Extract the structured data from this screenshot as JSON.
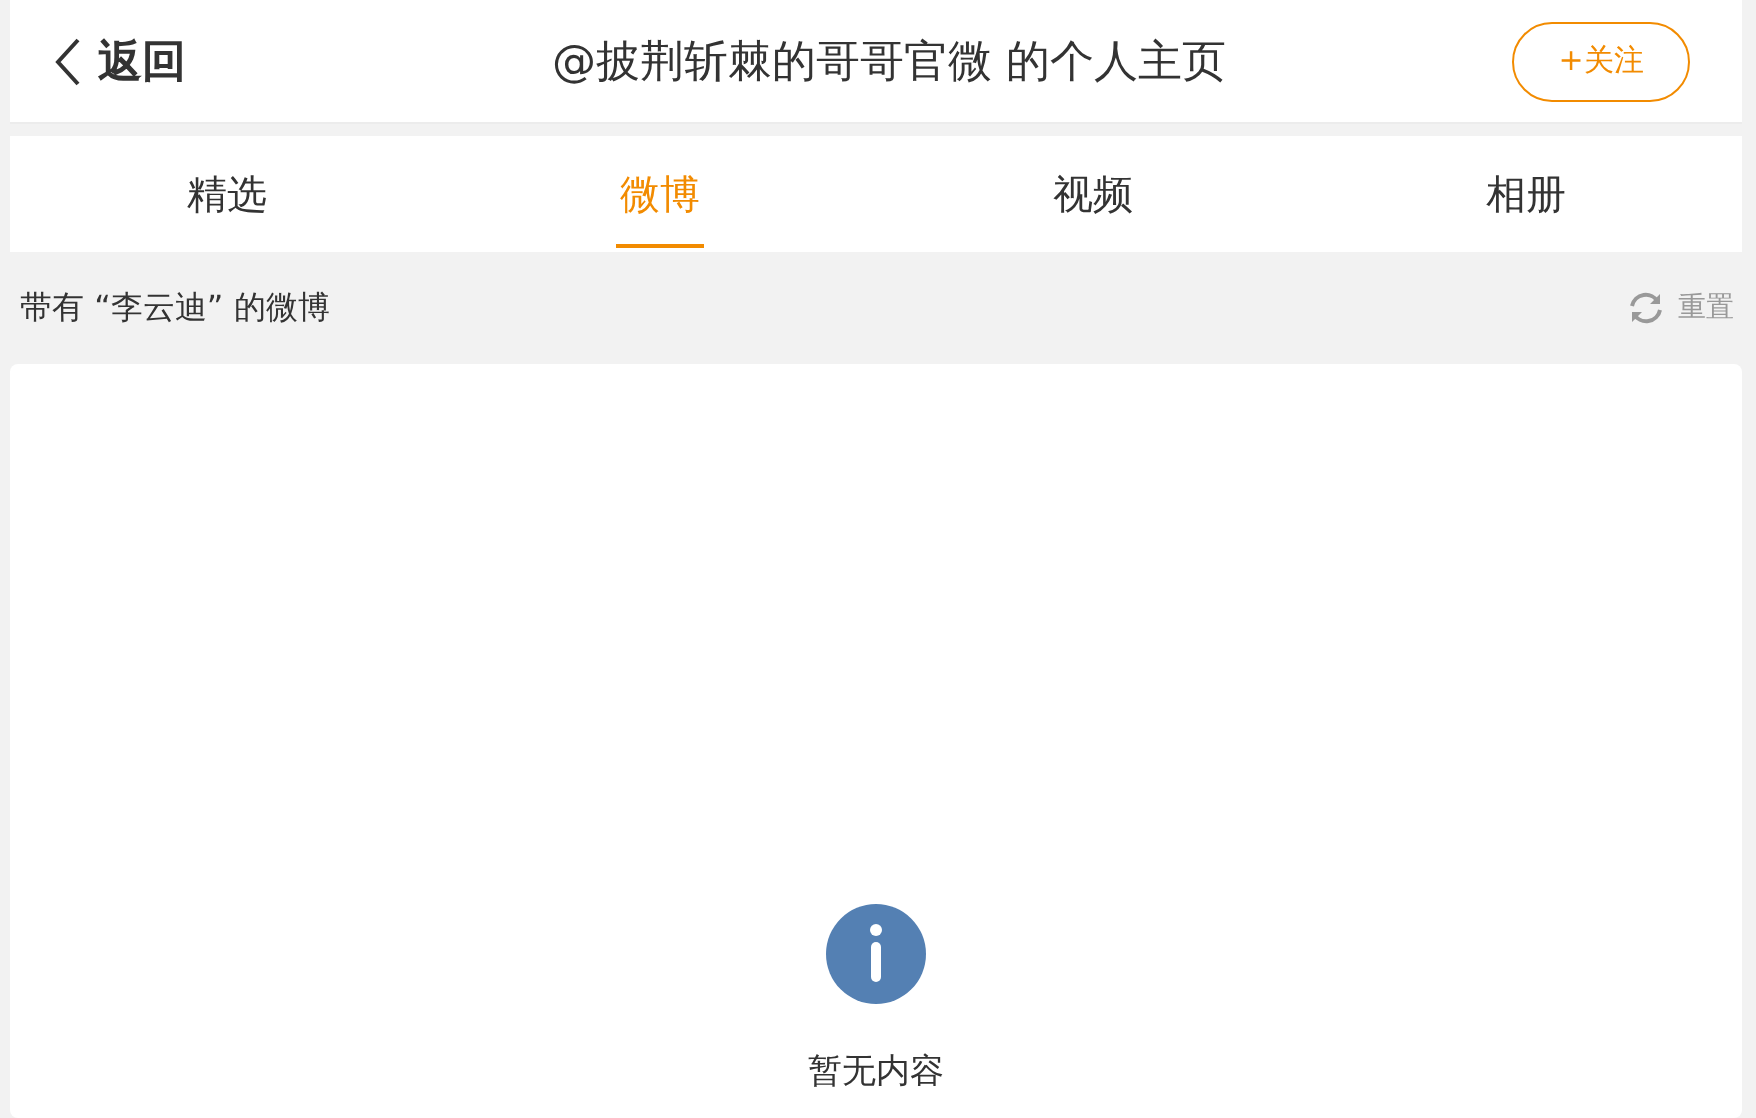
{
  "header": {
    "back_label": "返回",
    "title": "@披荆斩棘的哥哥官微 的个人主页",
    "follow_button": "+关注"
  },
  "tabs": [
    {
      "label": "精选",
      "selected": false
    },
    {
      "label": "微博",
      "selected": true
    },
    {
      "label": "视频",
      "selected": false
    },
    {
      "label": "相册",
      "selected": false
    }
  ],
  "filter": {
    "text": "带有 “李云迪” 的微博",
    "reset_label": "重置"
  },
  "empty_state": {
    "message": "暂无内容"
  }
}
